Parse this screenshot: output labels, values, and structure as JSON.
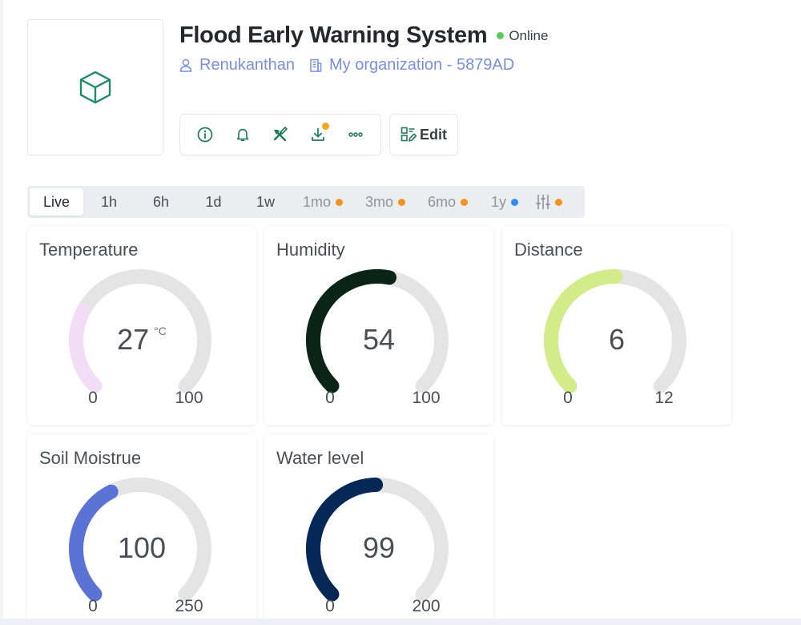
{
  "device": {
    "title": "Flood Early Warning System",
    "status": "Online",
    "status_color": "#5fc75c",
    "owner": "Renukanthan",
    "organization": "My organization - 5879AD",
    "thumbnail_icon": "cube-icon"
  },
  "actions": {
    "items": [
      {
        "name": "info-icon"
      },
      {
        "name": "bell-icon"
      },
      {
        "name": "tools-icon"
      },
      {
        "name": "download-icon",
        "badge": true
      },
      {
        "name": "more-icon"
      }
    ],
    "edit_label": "Edit"
  },
  "time_ranges": [
    {
      "label": "Live",
      "active": true
    },
    {
      "label": "1h"
    },
    {
      "label": "6h"
    },
    {
      "label": "1d"
    },
    {
      "label": "1w"
    },
    {
      "label": "1mo",
      "dot": "#f5931e",
      "muted": true
    },
    {
      "label": "3mo",
      "dot": "#f5931e",
      "muted": true
    },
    {
      "label": "6mo",
      "dot": "#f5931e",
      "muted": true
    },
    {
      "label": "1y",
      "dot": "#2f8ef0",
      "muted": true
    },
    {
      "label": "",
      "icon": "sliders-icon",
      "dot": "#f5931e",
      "muted": true
    }
  ],
  "gauges": [
    {
      "title": "Temperature",
      "value": 27,
      "display": "27",
      "unit": "°C",
      "min": 0,
      "max": 100,
      "min_label": "0",
      "max_label": "100",
      "color": "#f3dcf6"
    },
    {
      "title": "Humidity",
      "value": 54,
      "display": "54",
      "unit": "",
      "min": 0,
      "max": 100,
      "min_label": "0",
      "max_label": "100",
      "color": "#0b2418"
    },
    {
      "title": "Distance",
      "value": 6,
      "display": "6",
      "unit": "",
      "min": 0,
      "max": 12,
      "min_label": "0",
      "max_label": "12",
      "color": "#d3ec8a"
    },
    {
      "title": "Soil Moistrue",
      "value": 100,
      "display": "100",
      "unit": "",
      "min": 0,
      "max": 250,
      "min_label": "0",
      "max_label": "250",
      "color": "#5b73d5"
    },
    {
      "title": "Water level",
      "value": 99,
      "display": "99",
      "unit": "",
      "min": 0,
      "max": 200,
      "min_label": "0",
      "max_label": "200",
      "color": "#062856"
    }
  ]
}
